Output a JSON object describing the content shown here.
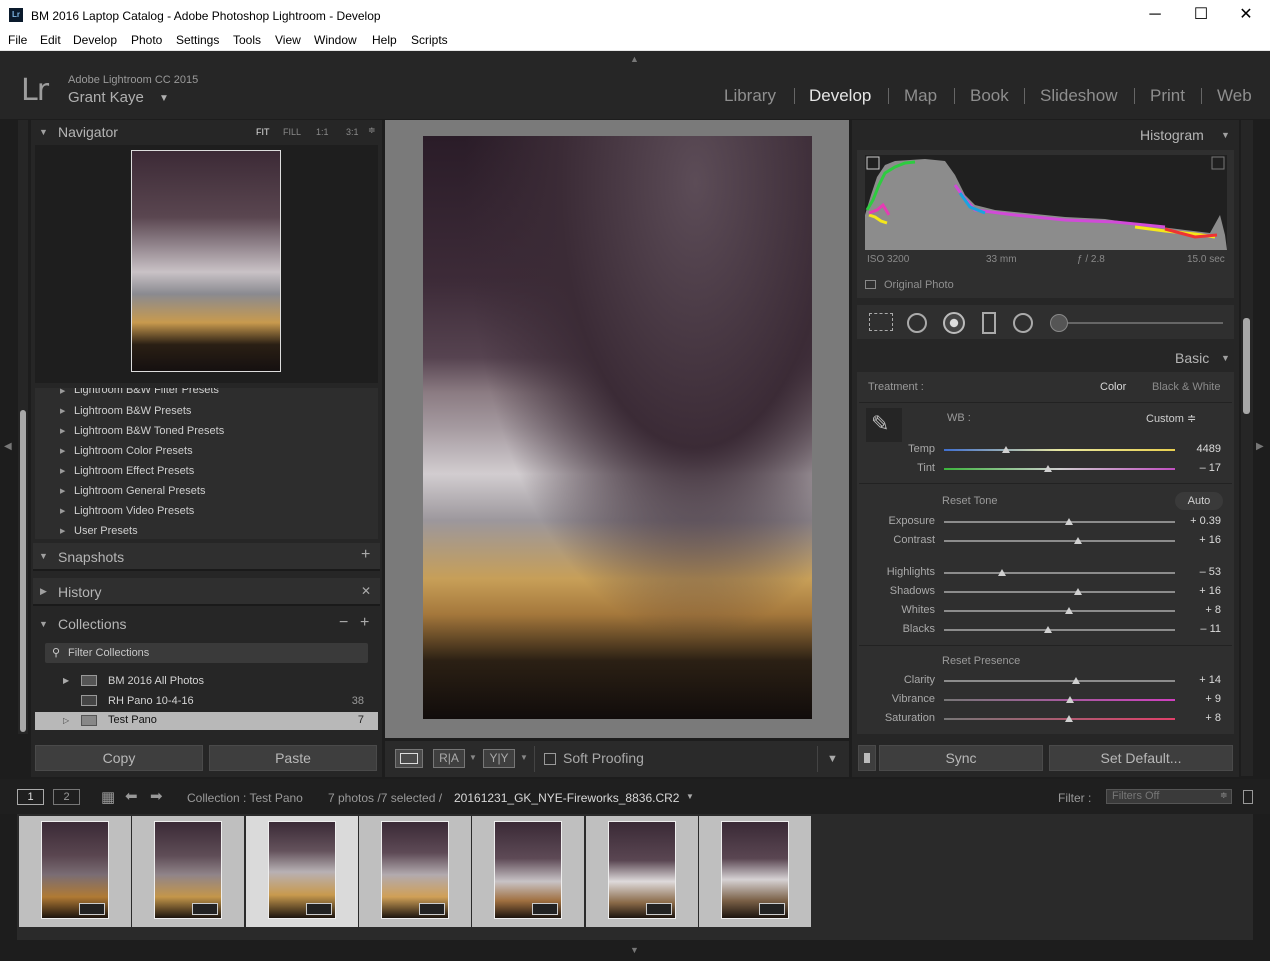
{
  "window": {
    "title": "BM 2016 Laptop Catalog - Adobe Photoshop Lightroom - Develop",
    "minimize": "─",
    "maximize": "☐",
    "close": "✕"
  },
  "menu": [
    "File",
    "Edit",
    "Develop",
    "Photo",
    "Settings",
    "Tools",
    "View",
    "Window",
    "Help",
    "Scripts"
  ],
  "identity": {
    "logo": "Lr",
    "app": "Adobe Lightroom CC 2015",
    "user": "Grant Kaye",
    "user_caret": "▼"
  },
  "modules": [
    "Library",
    "Develop",
    "Map",
    "Book",
    "Slideshow",
    "Print",
    "Web"
  ],
  "active_module": "Develop",
  "navigator": {
    "title": "Navigator",
    "zoom_options": [
      "FIT",
      "FILL",
      "1:1",
      "3:1"
    ],
    "active_zoom": "FIT"
  },
  "presets": [
    "Lightroom B&W Filter Presets",
    "Lightroom B&W Presets",
    "Lightroom B&W Toned Presets",
    "Lightroom Color Presets",
    "Lightroom Effect Presets",
    "Lightroom General Presets",
    "Lightroom Video Presets",
    "User Presets"
  ],
  "snapshots": {
    "title": "Snapshots",
    "action": "+"
  },
  "history": {
    "title": "History",
    "action": "✕"
  },
  "collections": {
    "title": "Collections",
    "minus": "−",
    "plus": "+",
    "filter_label": "Filter Collections",
    "items": [
      {
        "name": "BM 2016 All Photos",
        "count": ""
      },
      {
        "name": "RH Pano 10-4-16",
        "count": "38"
      },
      {
        "name": "Test Pano",
        "count": "7"
      }
    ]
  },
  "left_buttons": {
    "copy": "Copy",
    "paste": "Paste"
  },
  "toolbar": {
    "ra": "R|A",
    "yy": "Y|Y",
    "soft_proofing": "Soft Proofing"
  },
  "histogram": {
    "title": "Histogram",
    "iso": "ISO 3200",
    "focal": "33 mm",
    "aperture": "ƒ / 2.8",
    "shutter": "15.0 sec",
    "original_photo": "Original Photo"
  },
  "basic": {
    "title": "Basic",
    "treatment_label": "Treatment :",
    "treatment_color": "Color",
    "treatment_bw": "Black & White",
    "wb_label": "WB :",
    "wb_value": "Custom ≑",
    "reset_tone": "Reset Tone",
    "auto": "Auto",
    "reset_presence": "Reset Presence",
    "sliders": [
      {
        "label": "Temp",
        "value": "4489",
        "pos": 0.27
      },
      {
        "label": "Tint",
        "value": "– 17",
        "pos": 0.45
      },
      {
        "label": "Exposure",
        "value": "+ 0.39",
        "pos": 0.54
      },
      {
        "label": "Contrast",
        "value": "+ 16",
        "pos": 0.58
      },
      {
        "label": "Highlights",
        "value": "– 53",
        "pos": 0.25
      },
      {
        "label": "Shadows",
        "value": "+ 16",
        "pos": 0.58
      },
      {
        "label": "Whites",
        "value": "+ 8",
        "pos": 0.54
      },
      {
        "label": "Blacks",
        "value": "– 11",
        "pos": 0.45
      },
      {
        "label": "Clarity",
        "value": "+ 14",
        "pos": 0.57
      },
      {
        "label": "Vibrance",
        "value": "+ 9",
        "pos": 0.545
      },
      {
        "label": "Saturation",
        "value": "+ 8",
        "pos": 0.54
      }
    ]
  },
  "right_buttons": {
    "sync": "Sync",
    "set_default": "Set Default..."
  },
  "filmstrip_bar": {
    "screen1": "1",
    "screen2": "2",
    "source": "Collection : Test Pano",
    "count": "7 photos /7 selected /",
    "filename": "20161231_GK_NYE-Fireworks_8836.CR2",
    "filter_label": "Filter :",
    "filter_value": "Filters Off"
  },
  "filmstrip": {
    "thumb_count": 7,
    "selected_index": 2
  },
  "colors": {
    "background": "#1d1d1d",
    "panel": "#2b2b2b",
    "active_module": "#e6e6e6",
    "inactive_module": "#8e8e8e"
  }
}
